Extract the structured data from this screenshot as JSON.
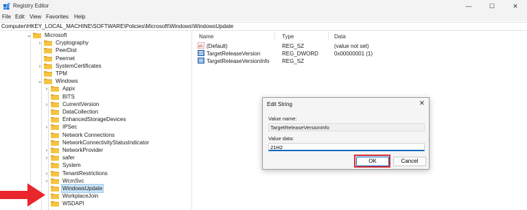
{
  "window": {
    "title": "Registry Editor",
    "minimize": "—",
    "maximize": "☐",
    "close": "✕"
  },
  "menu": [
    "File",
    "Edit",
    "View",
    "Favorites",
    "Help"
  ],
  "address": "Computer\\HKEY_LOCAL_MACHINE\\SOFTWARE\\Policies\\Microsoft\\Windows\\WindowsUpdate",
  "tree": {
    "items": [
      {
        "label": "Microsoft",
        "chevron": "v",
        "level": 0
      },
      {
        "label": "Cryptography",
        "chevron": ">",
        "level": 1
      },
      {
        "label": "PeerDist",
        "chevron": "",
        "level": 1
      },
      {
        "label": "Peernet",
        "chevron": "",
        "level": 1
      },
      {
        "label": "SystemCertificates",
        "chevron": ">",
        "level": 1
      },
      {
        "label": "TPM",
        "chevron": "",
        "level": 1
      },
      {
        "label": "Windows",
        "chevron": "v",
        "level": 1
      },
      {
        "label": "Appx",
        "chevron": ">",
        "level": 2
      },
      {
        "label": "BITS",
        "chevron": "",
        "level": 2
      },
      {
        "label": "CurrentVersion",
        "chevron": ">",
        "level": 2
      },
      {
        "label": "DataCollection",
        "chevron": "",
        "level": 2
      },
      {
        "label": "EnhancedStorageDevices",
        "chevron": "",
        "level": 2
      },
      {
        "label": "IPSec",
        "chevron": ">",
        "level": 2
      },
      {
        "label": "Network Connections",
        "chevron": "",
        "level": 2
      },
      {
        "label": "NetworkConnectivityStatusIndicator",
        "chevron": "",
        "level": 2
      },
      {
        "label": "NetworkProvider",
        "chevron": ">",
        "level": 2
      },
      {
        "label": "safer",
        "chevron": ">",
        "level": 2
      },
      {
        "label": "System",
        "chevron": "",
        "level": 2
      },
      {
        "label": "TenantRestrictions",
        "chevron": ">",
        "level": 2
      },
      {
        "label": "WcmSvc",
        "chevron": ">",
        "level": 2
      },
      {
        "label": "WindowsUpdate",
        "chevron": "",
        "level": 2,
        "selected": true
      },
      {
        "label": "WorkplaceJoin",
        "chevron": "",
        "level": 2
      },
      {
        "label": "WSDAPI",
        "chevron": "",
        "level": 2
      }
    ]
  },
  "list": {
    "columns": [
      "Name",
      "Type",
      "Data"
    ],
    "rows": [
      {
        "icon": "string-value-icon",
        "name": "(Default)",
        "type": "REG_SZ",
        "data": "(value not set)"
      },
      {
        "icon": "dword-value-icon",
        "name": "TargetReleaseVersion",
        "type": "REG_DWORD",
        "data": "0x00000001 (1)"
      },
      {
        "icon": "dword-value-icon",
        "name": "TargetReleaseVersionInfo",
        "type": "REG_SZ",
        "data": ""
      }
    ]
  },
  "dialog": {
    "title": "Edit String",
    "close": "✕",
    "value_name_label": "Value name:",
    "value_name": "TargetReleaseVersionInfo",
    "value_data_label": "Value data:",
    "value_data": "21H2",
    "ok": "OK",
    "cancel": "Cancel"
  },
  "colors": {
    "highlight": "#d7282f",
    "arrow": "#e8262b",
    "folder": "#f5c542",
    "selection": "#cce4f7",
    "accent": "#0067c0"
  }
}
